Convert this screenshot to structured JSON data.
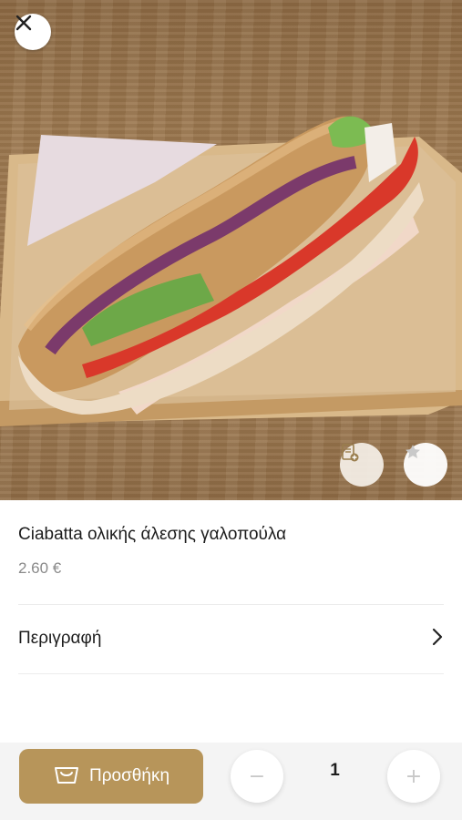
{
  "product": {
    "image_alt": "sandwich-photo",
    "title": "Ciabatta ολικής άλεσης γαλοπούλα",
    "price": "2.60 €"
  },
  "buttons": {
    "close_icon": "close-icon",
    "note_icon": "note-add-icon",
    "favorite_icon": "star-icon"
  },
  "description": {
    "label": "Περιγραφή",
    "chevron_icon": "chevron-right-icon"
  },
  "cart": {
    "add_label": "Προσθήκη",
    "add_icon": "basket-icon",
    "minus": "−",
    "plus": "+",
    "quantity": "1"
  },
  "colors": {
    "accent": "#b7955a",
    "price_grey": "#8a8a8a",
    "bottom_bar": "#f4f4f4"
  }
}
